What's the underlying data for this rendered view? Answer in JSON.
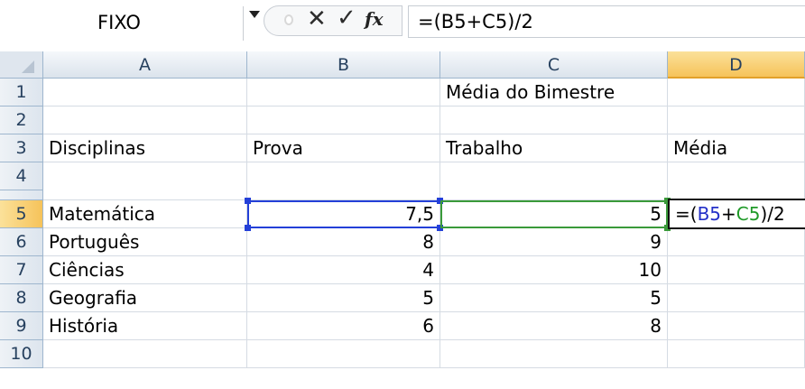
{
  "formula_bar": {
    "name_box": "FIXO",
    "cancel_icon": "cancel-icon",
    "enter_icon": "check-icon",
    "insert_function_icon": "fx-icon",
    "x_glyph": "✕",
    "check_glyph": "✓",
    "fx_glyph": "fx",
    "formula": "=(B5+C5)/2"
  },
  "columns": [
    "A",
    "B",
    "C",
    "D"
  ],
  "rows": [
    "1",
    "2",
    "3",
    "4",
    "5",
    "6",
    "7",
    "8",
    "9",
    "10"
  ],
  "cells": {
    "C1": "Média do Bimestre",
    "A3": "Disciplinas",
    "B3": "Prova",
    "C3": "Trabalho",
    "D3": "Média",
    "A5": "Matemática",
    "B5": "7,5",
    "C5": "5",
    "A6": "Português",
    "B6": "8",
    "C6": "9",
    "A7": "Ciências",
    "B7": "4",
    "C7": "10",
    "A8": "Geografia",
    "B8": "5",
    "C8": "5",
    "A9": "História",
    "B9": "6",
    "C9": "8"
  },
  "edit_cell": {
    "part1": "=(",
    "ref1": "B5",
    "plus": "+",
    "ref2": "C5",
    "part2": ")/2"
  },
  "colors": {
    "ref1": "#2430c8",
    "ref2": "#1f9a28",
    "selected_header": "#f6c35a",
    "header": "#dfe6ee"
  }
}
